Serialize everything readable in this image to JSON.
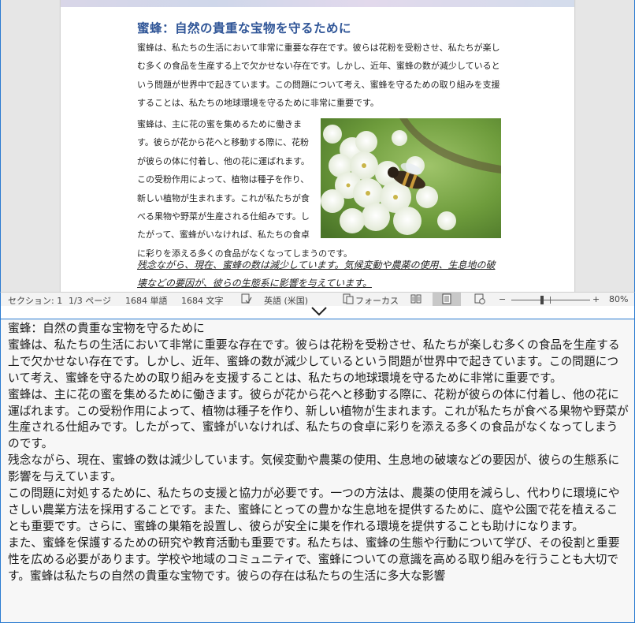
{
  "document": {
    "title": "蜜蜂：自然の貴重な宝物を守るために",
    "paragraph1": "蜜蜂は、私たちの生活において非常に重要な存在です。彼らは花粉を受粉させ、私たちが楽しむ多くの食品を生産する上で欠かせない存在です。しかし、近年、蜜蜂の数が減少しているという問題が世界中で起きています。この問題について考え、蜜蜂を守るための取り組みを支援することは、私たちの地球環境を守るために非常に重要です。",
    "paragraph2": "蜜蜂は、主に花の蜜を集めるために働きます。彼らが花から花へと移動する際に、花粉が彼らの体に付着し、他の花に運ばれます。この受粉作用によって、植物は種子を作り、新しい植物が生まれます。これが私たちが食べる果物や野菜が生産される仕組みです。したがって、蜜蜂がいなければ、私たちの食卓に彩りを添える多くの食品がなくなってしまうのです。",
    "paragraph3": "残念ながら、現在、蜜蜂の数は減少しています。気候変動や農薬の使用、生息地の破壊などの要因が、彼らの生態系に影響を与えています。"
  },
  "status_bar": {
    "section": "セクション: 1",
    "page": "1/3 ページ",
    "words": "1684 単語",
    "chars": "1684 文字",
    "language": "英語 (米国)",
    "focus": "フォーカス",
    "zoom_minus": "−",
    "zoom_plus": "+",
    "zoom": "80%"
  },
  "text_viewer": {
    "lines": [
      "蜜蜂：自然の貴重な宝物を守るために",
      "蜜蜂は、私たちの生活において非常に重要な存在です。彼らは花粉を受粉させ、私たちが楽しむ多くの食品を生産する上で欠かせない存在です。しかし、近年、蜜蜂の数が減少しているという問題が世界中で起きています。この問題について考え、蜜蜂を守るための取り組みを支援することは、私たちの地球環境を守るために非常に重要です。",
      "蜜蜂は、主に花の蜜を集めるために働きます。彼らが花から花へと移動する際に、花粉が彼らの体に付着し、他の花に運ばれます。この受粉作用によって、植物は種子を作り、新しい植物が生まれます。これが私たちが食べる果物や野菜が生産される仕組みです。したがって、蜜蜂がいなければ、私たちの食卓に彩りを添える多くの食品がなくなってしまうのです。",
      "残念ながら、現在、蜜蜂の数は減少しています。気候変動や農薬の使用、生息地の破壊などの要因が、彼らの生態系に影響を与えています。",
      "この問題に対処するために、私たちの支援と協力が必要です。一つの方法は、農薬の使用を減らし、代わりに環境にやさしい農業方法を採用することです。また、蜜蜂にとっての豊かな生息地を提供するために、庭や公園で花を植えることも重要です。さらに、蜜蜂の巣箱を設置し、彼らが安全に巣を作れる環境を提供することも助けになります。",
      "また、蜜蜂を保護するための研究や教育活動も重要です。私たちは、蜜蜂の生態や行動について学び、その役割と重要性を広める必要があります。学校や地域のコミュニティで、蜜蜂についての意識を高める取り組みを行うことも大切です。蜜蜂は私たちの自然の貴重な宝物です。彼らの存在は私たちの生活に多大な影響"
    ]
  },
  "colors": {
    "title_blue": "#2f5597",
    "border_blue": "#2b7bd1",
    "status_bg": "#f3f3f3"
  },
  "icons": [
    "proofing-icon",
    "focus-icon",
    "read-mode-icon",
    "print-layout-icon",
    "web-layout-icon",
    "splitter-chevron-icon",
    "bee-flower-photo"
  ]
}
